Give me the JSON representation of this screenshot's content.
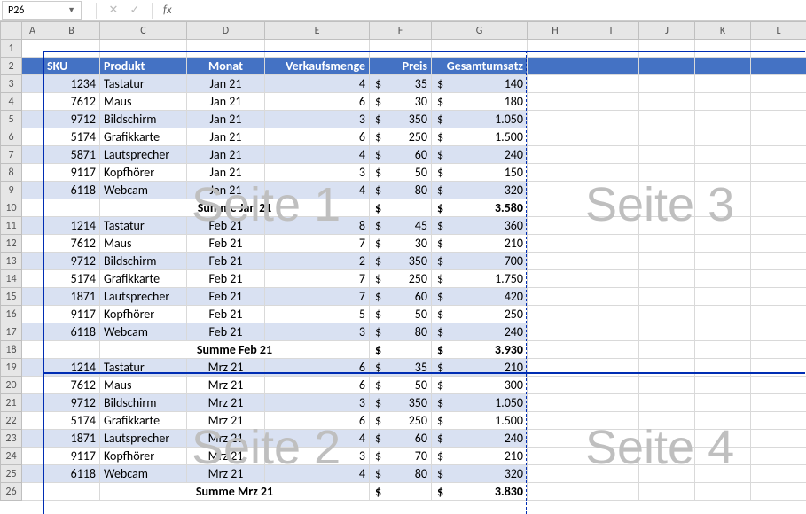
{
  "namebox": {
    "value": "P26"
  },
  "formula_bar": {
    "cancel": "✕",
    "confirm": "✓",
    "fx": "fx",
    "value": ""
  },
  "columns": [
    "A",
    "B",
    "C",
    "D",
    "E",
    "F",
    "G",
    "H",
    "I",
    "J",
    "K",
    "L"
  ],
  "row_numbers": [
    1,
    2,
    3,
    4,
    5,
    6,
    7,
    8,
    9,
    10,
    11,
    12,
    13,
    14,
    15,
    16,
    17,
    18,
    19,
    20,
    21,
    22,
    23,
    24,
    25,
    26
  ],
  "headers": {
    "sku": "SKU",
    "produkt": "Produkt",
    "monat": "Monat",
    "menge": "Verkaufsmenge",
    "preis": "Preis",
    "umsatz": "Gesamtumsatz"
  },
  "watermarks": {
    "s1": "Seite 1",
    "s2": "Seite 2",
    "s3": "Seite 3",
    "s4": "Seite 4"
  },
  "rows": [
    {
      "sku": "1234",
      "prod": "Tastatur",
      "mon": "Jan 21",
      "menge": "4",
      "preis": "35",
      "umsatz": "140",
      "band": true
    },
    {
      "sku": "7612",
      "prod": "Maus",
      "mon": "Jan 21",
      "menge": "6",
      "preis": "30",
      "umsatz": "180",
      "band": false
    },
    {
      "sku": "9712",
      "prod": "Bildschirm",
      "mon": "Jan 21",
      "menge": "3",
      "preis": "350",
      "umsatz": "1.050",
      "band": true
    },
    {
      "sku": "5174",
      "prod": "Grafikkarte",
      "mon": "Jan 21",
      "menge": "6",
      "preis": "250",
      "umsatz": "1.500",
      "band": false
    },
    {
      "sku": "5871",
      "prod": "Lautsprecher",
      "mon": "Jan 21",
      "menge": "4",
      "preis": "60",
      "umsatz": "240",
      "band": true
    },
    {
      "sku": "9117",
      "prod": "Kopfhörer",
      "mon": "Jan 21",
      "menge": "3",
      "preis": "50",
      "umsatz": "150",
      "band": false
    },
    {
      "sku": "6118",
      "prod": "Webcam",
      "mon": "Jan 21",
      "menge": "4",
      "preis": "80",
      "umsatz": "320",
      "band": true
    },
    {
      "sum": true,
      "label": "Summe Jan 21",
      "umsatz": "3.580",
      "band": false
    },
    {
      "sku": "1214",
      "prod": "Tastatur",
      "mon": "Feb 21",
      "menge": "8",
      "preis": "45",
      "umsatz": "360",
      "band": true
    },
    {
      "sku": "7612",
      "prod": "Maus",
      "mon": "Feb 21",
      "menge": "7",
      "preis": "30",
      "umsatz": "210",
      "band": false
    },
    {
      "sku": "9712",
      "prod": "Bildschirm",
      "mon": "Feb 21",
      "menge": "2",
      "preis": "350",
      "umsatz": "700",
      "band": true
    },
    {
      "sku": "5174",
      "prod": "Grafikkarte",
      "mon": "Feb 21",
      "menge": "7",
      "preis": "250",
      "umsatz": "1.750",
      "band": false
    },
    {
      "sku": "1871",
      "prod": "Lautsprecher",
      "mon": "Feb 21",
      "menge": "7",
      "preis": "60",
      "umsatz": "420",
      "band": true
    },
    {
      "sku": "9117",
      "prod": "Kopfhörer",
      "mon": "Feb 21",
      "menge": "5",
      "preis": "50",
      "umsatz": "250",
      "band": false
    },
    {
      "sku": "6118",
      "prod": "Webcam",
      "mon": "Feb 21",
      "menge": "3",
      "preis": "80",
      "umsatz": "240",
      "band": true
    },
    {
      "sum": true,
      "label": "Summe Feb 21",
      "umsatz": "3.930",
      "band": false
    },
    {
      "sku": "1214",
      "prod": "Tastatur",
      "mon": "Mrz 21",
      "menge": "6",
      "preis": "35",
      "umsatz": "210",
      "band": true
    },
    {
      "sku": "7612",
      "prod": "Maus",
      "mon": "Mrz 21",
      "menge": "6",
      "preis": "50",
      "umsatz": "300",
      "band": false
    },
    {
      "sku": "9712",
      "prod": "Bildschirm",
      "mon": "Mrz 21",
      "menge": "3",
      "preis": "350",
      "umsatz": "1.050",
      "band": true
    },
    {
      "sku": "5174",
      "prod": "Grafikkarte",
      "mon": "Mrz 21",
      "menge": "6",
      "preis": "250",
      "umsatz": "1.500",
      "band": false
    },
    {
      "sku": "1871",
      "prod": "Lautsprecher",
      "mon": "Mrz 21",
      "menge": "4",
      "preis": "60",
      "umsatz": "240",
      "band": true
    },
    {
      "sku": "9117",
      "prod": "Kopfhörer",
      "mon": "Mrz 21",
      "menge": "3",
      "preis": "70",
      "umsatz": "210",
      "band": false
    },
    {
      "sku": "6118",
      "prod": "Webcam",
      "mon": "Mrz 21",
      "menge": "4",
      "preis": "80",
      "umsatz": "320",
      "band": true
    },
    {
      "sum": true,
      "label": "Summe Mrz 21",
      "umsatz": "3.830",
      "band": false
    }
  ],
  "currency": "$"
}
